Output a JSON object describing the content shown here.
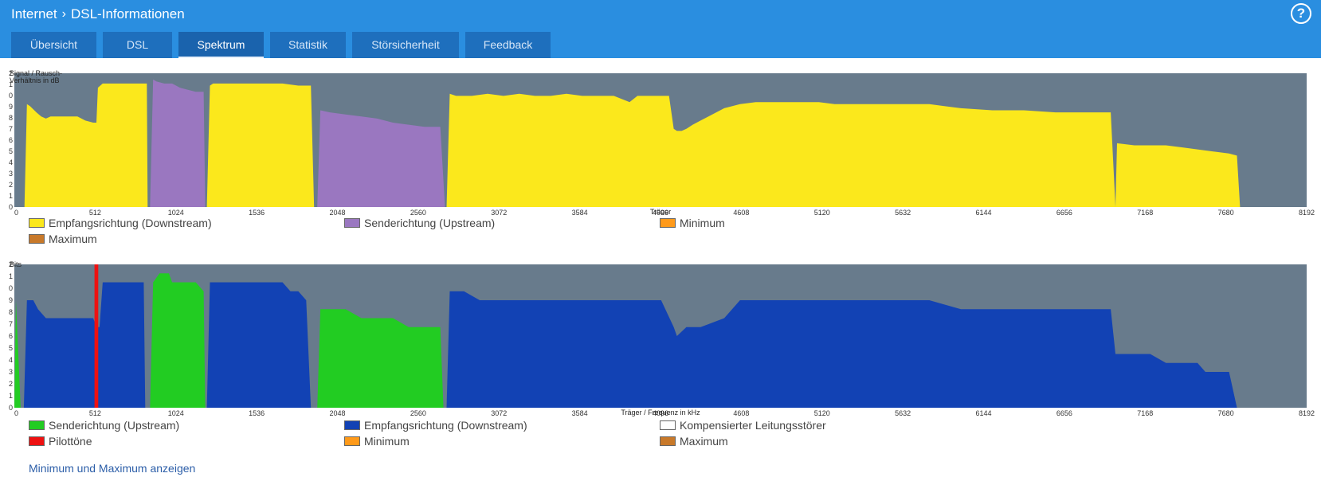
{
  "header": {
    "breadcrumb": [
      "Internet",
      "DSL-Informationen"
    ],
    "help_label": "?"
  },
  "tabs": [
    {
      "label": "Übersicht",
      "active": false
    },
    {
      "label": "DSL",
      "active": false
    },
    {
      "label": "Spektrum",
      "active": true
    },
    {
      "label": "Statistik",
      "active": false
    },
    {
      "label": "Störsicherheit",
      "active": false
    },
    {
      "label": "Feedback",
      "active": false
    }
  ],
  "colors": {
    "header_bg": "#2a8ee0",
    "tab_bg": "#1e6fbd",
    "plot_bg": "#687b8c",
    "downstream_yellow": "#fbe81c",
    "upstream_purple": "#9a77c0",
    "upstream_green": "#22cc22",
    "downstream_blue": "#1242b4",
    "pilot_red": "#ee1111",
    "minimum_orange": "#ff9a1a",
    "maximum_brown": "#c8792a",
    "kompensiert_white": "#ffffff"
  },
  "chart_data": [
    {
      "type": "area",
      "ylabel": "Signal / Rausch-Verhältnis in dB",
      "xlabel": "Träger",
      "xlim": [
        0,
        8192
      ],
      "ylim": [
        0,
        65
      ],
      "x_ticks": [
        "0",
        "512",
        "1024",
        "1536",
        "2048",
        "2560",
        "3072",
        "3584",
        "4096",
        "4608",
        "5120",
        "5632",
        "6144",
        "6656",
        "7168",
        "7680",
        "8192"
      ],
      "legend": [
        {
          "label": "Empfangsrichtung (Downstream)",
          "color": "#fbe81c"
        },
        {
          "label": "Senderichtung (Upstream)",
          "color": "#9a77c0"
        },
        {
          "label": "Minimum",
          "color": "#ff9a1a"
        },
        {
          "label": "Maximum",
          "color": "#c8792a"
        }
      ],
      "series": [
        {
          "name": "Empfangsrichtung (Downstream)",
          "color": "#fbe81c",
          "points": [
            [
              64,
              0
            ],
            [
              80,
              50
            ],
            [
              100,
              49
            ],
            [
              140,
              46
            ],
            [
              170,
              44
            ],
            [
              200,
              43
            ],
            [
              230,
              44
            ],
            [
              260,
              44
            ],
            [
              300,
              44
            ],
            [
              350,
              44
            ],
            [
              400,
              44
            ],
            [
              450,
              42
            ],
            [
              500,
              41
            ],
            [
              520,
              41
            ],
            [
              530,
              58
            ],
            [
              560,
              60
            ],
            [
              600,
              60
            ],
            [
              700,
              60
            ],
            [
              800,
              60
            ],
            [
              840,
              60
            ],
            [
              845,
              0
            ]
          ]
        },
        {
          "name": "Senderichtung (Upstream)",
          "color": "#9a77c0",
          "points": [
            [
              860,
              0
            ],
            [
              880,
              62
            ],
            [
              900,
              61
            ],
            [
              950,
              60
            ],
            [
              1000,
              60
            ],
            [
              1050,
              58
            ],
            [
              1100,
              57
            ],
            [
              1150,
              56
            ],
            [
              1200,
              56
            ],
            [
              1210,
              0
            ]
          ]
        },
        {
          "name": "Empfangsrichtung (Downstream)",
          "color": "#fbe81c",
          "points": [
            [
              1220,
              0
            ],
            [
              1240,
              59
            ],
            [
              1260,
              60
            ],
            [
              1400,
              60
            ],
            [
              1600,
              60
            ],
            [
              1700,
              60
            ],
            [
              1800,
              59
            ],
            [
              1880,
              59
            ],
            [
              1900,
              0
            ]
          ]
        },
        {
          "name": "Senderichtung (Upstream)",
          "color": "#9a77c0",
          "points": [
            [
              1920,
              0
            ],
            [
              1940,
              47
            ],
            [
              2000,
              46
            ],
            [
              2100,
              45
            ],
            [
              2200,
              44
            ],
            [
              2300,
              43
            ],
            [
              2400,
              41
            ],
            [
              2500,
              40
            ],
            [
              2600,
              39
            ],
            [
              2700,
              39
            ],
            [
              2730,
              0
            ]
          ]
        },
        {
          "name": "Empfangsrichtung (Downstream)",
          "color": "#fbe81c",
          "points": [
            [
              2740,
              0
            ],
            [
              2760,
              55
            ],
            [
              2800,
              54
            ],
            [
              2900,
              54
            ],
            [
              3000,
              55
            ],
            [
              3100,
              54
            ],
            [
              3200,
              55
            ],
            [
              3300,
              54
            ],
            [
              3400,
              54
            ],
            [
              3500,
              55
            ],
            [
              3600,
              54
            ],
            [
              3700,
              54
            ],
            [
              3800,
              54
            ],
            [
              3900,
              51
            ],
            [
              3950,
              54
            ],
            [
              4050,
              54
            ],
            [
              4150,
              54
            ],
            [
              4180,
              38
            ],
            [
              4200,
              37
            ],
            [
              4230,
              37
            ],
            [
              4260,
              38
            ],
            [
              4300,
              40
            ],
            [
              4350,
              42
            ],
            [
              4400,
              44
            ],
            [
              4500,
              48
            ],
            [
              4600,
              50
            ],
            [
              4700,
              51
            ],
            [
              4800,
              51
            ],
            [
              4900,
              51
            ],
            [
              5000,
              51
            ],
            [
              5100,
              51
            ],
            [
              5200,
              50
            ],
            [
              5400,
              50
            ],
            [
              5600,
              50
            ],
            [
              5800,
              50
            ],
            [
              5900,
              49
            ],
            [
              6000,
              48
            ],
            [
              6200,
              47
            ],
            [
              6400,
              47
            ],
            [
              6600,
              46
            ],
            [
              6800,
              46
            ],
            [
              6950,
              46
            ],
            [
              6980,
              0
            ]
          ]
        },
        {
          "name": "Empfangsrichtung (Downstream)",
          "color": "#fbe81c",
          "points": [
            [
              6980,
              0
            ],
            [
              6990,
              31
            ],
            [
              7100,
              30
            ],
            [
              7300,
              30
            ],
            [
              7400,
              29
            ],
            [
              7500,
              28
            ],
            [
              7600,
              27
            ],
            [
              7700,
              26
            ],
            [
              7750,
              25
            ],
            [
              7770,
              0
            ]
          ]
        }
      ]
    },
    {
      "type": "area",
      "ylabel": "Bits",
      "xlabel": "Träger / Frequenz in kHz",
      "xlim": [
        0,
        8192
      ],
      "ylim": [
        0,
        16
      ],
      "x_ticks": [
        "0",
        "512",
        "1024",
        "1536",
        "2048",
        "2560",
        "3072",
        "3584",
        "4096",
        "4608",
        "5120",
        "5632",
        "6144",
        "6656",
        "7168",
        "7680",
        "8192"
      ],
      "legend": [
        {
          "label": "Senderichtung (Upstream)",
          "color": "#22cc22"
        },
        {
          "label": "Empfangsrichtung (Downstream)",
          "color": "#1242b4"
        },
        {
          "label": "Kompensierter Leitungsstörer",
          "color": "#ffffff"
        },
        {
          "label": "Pilottöne",
          "color": "#ee1111"
        },
        {
          "label": "Minimum",
          "color": "#ff9a1a"
        },
        {
          "label": "Maximum",
          "color": "#c8792a"
        }
      ],
      "series": [
        {
          "name": "Senderichtung (Upstream)",
          "color": "#22cc22",
          "points": [
            [
              0,
              0
            ],
            [
              10,
              12
            ],
            [
              40,
              0
            ]
          ]
        },
        {
          "name": "Empfangsrichtung (Downstream)",
          "color": "#1242b4",
          "points": [
            [
              60,
              0
            ],
            [
              80,
              12
            ],
            [
              120,
              12
            ],
            [
              150,
              11
            ],
            [
              200,
              10
            ],
            [
              300,
              10
            ],
            [
              400,
              10
            ],
            [
              500,
              10
            ],
            [
              520,
              9
            ],
            [
              540,
              9
            ],
            [
              560,
              14
            ],
            [
              700,
              14
            ],
            [
              820,
              14
            ],
            [
              830,
              0
            ]
          ]
        },
        {
          "name": "Senderichtung (Upstream)",
          "color": "#22cc22",
          "points": [
            [
              860,
              0
            ],
            [
              880,
              14
            ],
            [
              920,
              15
            ],
            [
              980,
              15
            ],
            [
              1000,
              14
            ],
            [
              1150,
              14
            ],
            [
              1200,
              13
            ],
            [
              1210,
              0
            ]
          ]
        },
        {
          "name": "Empfangsrichtung (Downstream)",
          "color": "#1242b4",
          "points": [
            [
              1220,
              0
            ],
            [
              1240,
              14
            ],
            [
              1400,
              14
            ],
            [
              1600,
              14
            ],
            [
              1700,
              14
            ],
            [
              1750,
              13
            ],
            [
              1800,
              13
            ],
            [
              1850,
              12
            ],
            [
              1880,
              0
            ]
          ]
        },
        {
          "name": "Senderichtung (Upstream)",
          "color": "#22cc22",
          "points": [
            [
              1920,
              0
            ],
            [
              1940,
              11
            ],
            [
              2100,
              11
            ],
            [
              2200,
              10
            ],
            [
              2400,
              10
            ],
            [
              2500,
              9
            ],
            [
              2700,
              9
            ],
            [
              2720,
              0
            ]
          ]
        },
        {
          "name": "Empfangsrichtung (Downstream)",
          "color": "#1242b4",
          "points": [
            [
              2740,
              0
            ],
            [
              2760,
              13
            ],
            [
              2850,
              13
            ],
            [
              2950,
              12
            ],
            [
              3100,
              12
            ],
            [
              3300,
              12
            ],
            [
              3500,
              12
            ],
            [
              3700,
              12
            ],
            [
              3900,
              12
            ],
            [
              4100,
              12
            ],
            [
              4180,
              9
            ],
            [
              4200,
              8
            ],
            [
              4260,
              9
            ],
            [
              4350,
              9
            ],
            [
              4500,
              10
            ],
            [
              4600,
              12
            ],
            [
              4800,
              12
            ],
            [
              5000,
              12
            ],
            [
              5200,
              12
            ],
            [
              5400,
              12
            ],
            [
              5600,
              12
            ],
            [
              5800,
              12
            ],
            [
              6000,
              11
            ],
            [
              6200,
              11
            ],
            [
              6400,
              11
            ],
            [
              6600,
              11
            ],
            [
              6800,
              11
            ],
            [
              6950,
              11
            ],
            [
              6980,
              6
            ],
            [
              7100,
              6
            ],
            [
              7200,
              6
            ],
            [
              7300,
              5
            ],
            [
              7400,
              5
            ],
            [
              7500,
              5
            ],
            [
              7550,
              4
            ],
            [
              7700,
              4
            ],
            [
              7750,
              0
            ]
          ]
        },
        {
          "name": "Pilottöne",
          "color": "#ee1111",
          "points": [
            [
              508,
              0
            ],
            [
              508,
              16
            ],
            [
              532,
              16
            ],
            [
              532,
              0
            ]
          ]
        }
      ]
    }
  ],
  "chart1_ylabel_lines": [
    "Signal / Rausch-",
    "Verhältnis in dB"
  ],
  "link": {
    "label": "Minimum und Maximum anzeigen"
  }
}
